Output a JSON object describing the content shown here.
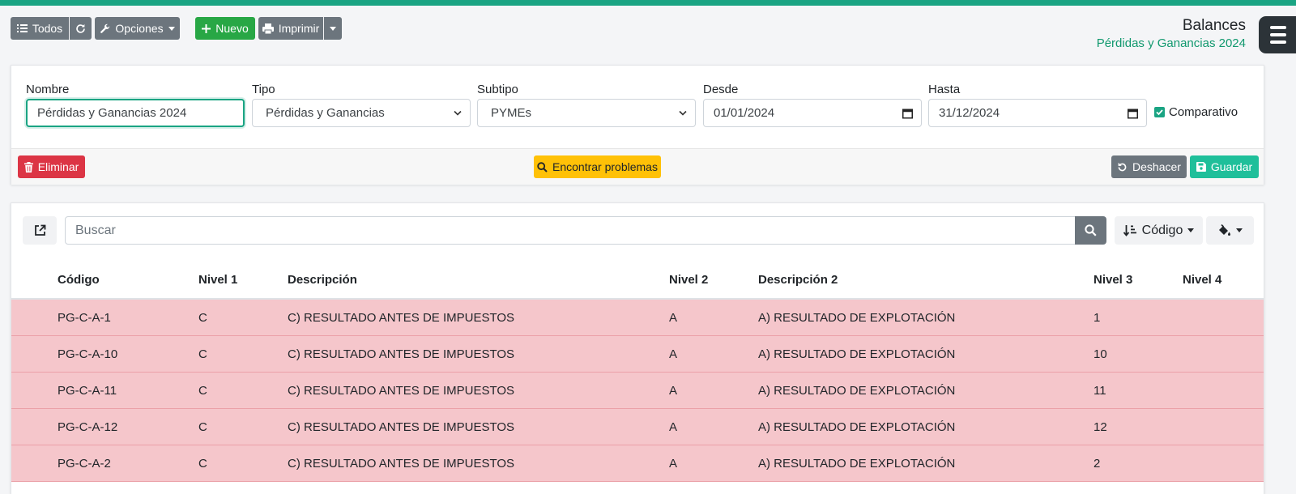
{
  "toolbar": {
    "todos_label": "Todos",
    "opciones_label": "Opciones",
    "nuevo_label": "Nuevo",
    "imprimir_label": "Imprimir"
  },
  "header": {
    "title": "Balances",
    "subtitle": "Pérdidas y Ganancias 2024"
  },
  "form": {
    "nombre_label": "Nombre",
    "nombre_value": "Pérdidas y Ganancias 2024",
    "tipo_label": "Tipo",
    "tipo_value": "Pérdidas y Ganancias",
    "subtipo_label": "Subtipo",
    "subtipo_value": "PYMEs",
    "desde_label": "Desde",
    "desde_value": "01/01/2024",
    "hasta_label": "Hasta",
    "hasta_value": "31/12/2024",
    "comparativo_label": "Comparativo",
    "comparativo_checked": true,
    "eliminar_label": "Eliminar",
    "problemas_label": "Encontrar problemas",
    "deshacer_label": "Deshacer",
    "guardar_label": "Guardar"
  },
  "list": {
    "search_placeholder": "Buscar",
    "sort_label": "Código",
    "columns": [
      "Código",
      "Nivel 1",
      "Descripción",
      "Nivel 2",
      "Descripción 2",
      "Nivel 3",
      "Nivel 4"
    ],
    "rows": [
      [
        "PG-C-A-1",
        "C",
        "C) RESULTADO ANTES DE IMPUESTOS",
        "A",
        "A) RESULTADO DE EXPLOTACIÓN",
        "1",
        ""
      ],
      [
        "PG-C-A-10",
        "C",
        "C) RESULTADO ANTES DE IMPUESTOS",
        "A",
        "A) RESULTADO DE EXPLOTACIÓN",
        "10",
        ""
      ],
      [
        "PG-C-A-11",
        "C",
        "C) RESULTADO ANTES DE IMPUESTOS",
        "A",
        "A) RESULTADO DE EXPLOTACIÓN",
        "11",
        ""
      ],
      [
        "PG-C-A-12",
        "C",
        "C) RESULTADO ANTES DE IMPUESTOS",
        "A",
        "A) RESULTADO DE EXPLOTACIÓN",
        "12",
        ""
      ],
      [
        "PG-C-A-2",
        "C",
        "C) RESULTADO ANTES DE IMPUESTOS",
        "A",
        "A) RESULTADO DE EXPLOTACIÓN",
        "2",
        ""
      ]
    ]
  },
  "colors": {
    "accent": "#1aa483",
    "row_warning": "#f5c6cb",
    "danger": "#dc3545",
    "success": "#28a745",
    "warning": "#ffc107"
  }
}
